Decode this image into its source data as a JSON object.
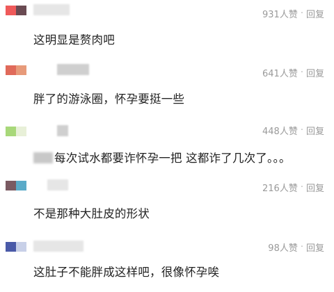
{
  "comments": [
    {
      "avatar_colors": [
        "#ef5a5a",
        "#6a4a52"
      ],
      "likes": "931人赞",
      "separator": "·",
      "reply": "回复",
      "text": "这明显是赘肉吧"
    },
    {
      "avatar_colors": [
        "#e06a5a",
        "#e79a7a"
      ],
      "likes": "641人赞",
      "separator": "·",
      "reply": "回复",
      "text": "胖了的游泳圈，怀孕要挺一些"
    },
    {
      "avatar_colors": [
        "#a8d87a",
        "#e8f0d8"
      ],
      "likes": "448人赞",
      "separator": "·",
      "reply": "回复",
      "text": "每次试水都要诈怀孕一把 这都诈了几次了。。。"
    },
    {
      "avatar_colors": [
        "#7a5a62",
        "#5aaac8"
      ],
      "likes": "216人赞",
      "separator": "·",
      "reply": "回复",
      "text": "不是那种大肚皮的形状"
    },
    {
      "avatar_colors": [
        "#4a5aa8",
        "#c8d0e8"
      ],
      "likes": "98人赞",
      "separator": "·",
      "reply": "回复",
      "text": "这肚子不能胖成这样吧，很像怀孕唉"
    }
  ]
}
